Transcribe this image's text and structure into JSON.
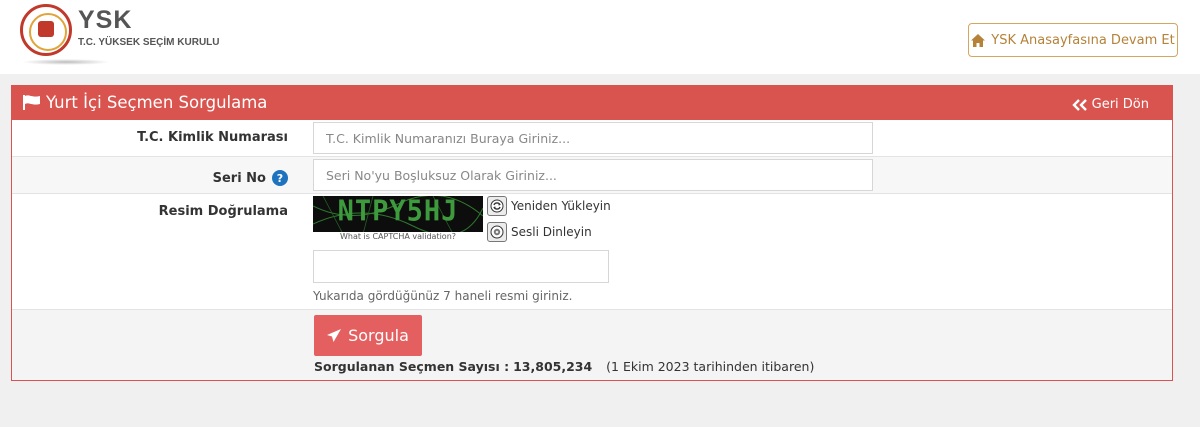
{
  "header": {
    "brand": "YSK",
    "brand_sub": "T.C. YÜKSEK SEÇİM KURULU",
    "home_button": "YSK Anasayfasına Devam Et"
  },
  "panel": {
    "title": "Yurt İçi Seçmen Sorgulama",
    "back": "Geri Dön",
    "accent_color": "#d9534f"
  },
  "form": {
    "tc_label": "T.C. Kimlik Numarası",
    "tc_placeholder": "T.C. Kimlik Numaranızı Buraya Giriniz...",
    "seri_label": "Seri No",
    "seri_placeholder": "Seri No'yu Boşluksuz Olarak Giriniz...",
    "captcha_label": "Resim Doğrulama",
    "captcha_text": "NTPY5HJ",
    "captcha_caption": "What is CAPTCHA validation?",
    "reload": "Yeniden Yükleyin",
    "audio": "Sesli Dinleyin",
    "captcha_hint": "Yukarıda gördüğünüz 7 haneli resmi giriniz.",
    "submit": "Sorgula",
    "count_label": "Sorgulanan Seçmen Sayısı :",
    "count_value": "13,805,234",
    "count_since": "(1 Ekim 2023 tarihinden itibaren)"
  },
  "icons": [
    "ysk-seal-logo",
    "home-icon",
    "flag-icon",
    "double-chevron-left-icon",
    "help-icon",
    "reload-icon",
    "audio-icon",
    "send-icon"
  ]
}
